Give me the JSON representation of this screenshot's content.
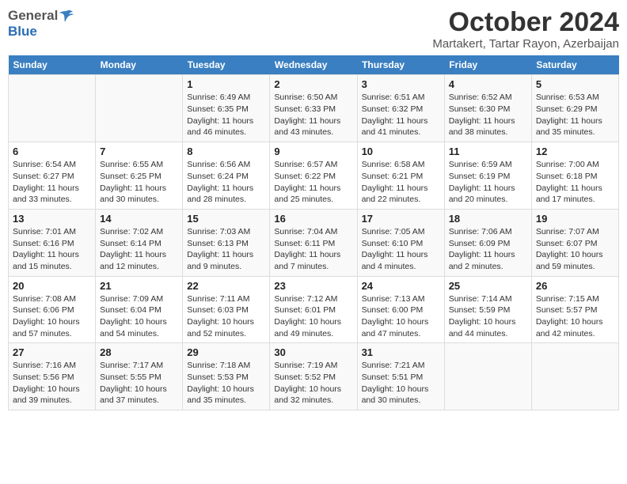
{
  "header": {
    "logo_general": "General",
    "logo_blue": "Blue",
    "month_title": "October 2024",
    "location": "Martakert, Tartar Rayon, Azerbaijan"
  },
  "weekdays": [
    "Sunday",
    "Monday",
    "Tuesday",
    "Wednesday",
    "Thursday",
    "Friday",
    "Saturday"
  ],
  "weeks": [
    [
      {
        "day": "",
        "sunrise": "",
        "sunset": "",
        "daylight": ""
      },
      {
        "day": "",
        "sunrise": "",
        "sunset": "",
        "daylight": ""
      },
      {
        "day": "1",
        "sunrise": "Sunrise: 6:49 AM",
        "sunset": "Sunset: 6:35 PM",
        "daylight": "Daylight: 11 hours and 46 minutes."
      },
      {
        "day": "2",
        "sunrise": "Sunrise: 6:50 AM",
        "sunset": "Sunset: 6:33 PM",
        "daylight": "Daylight: 11 hours and 43 minutes."
      },
      {
        "day": "3",
        "sunrise": "Sunrise: 6:51 AM",
        "sunset": "Sunset: 6:32 PM",
        "daylight": "Daylight: 11 hours and 41 minutes."
      },
      {
        "day": "4",
        "sunrise": "Sunrise: 6:52 AM",
        "sunset": "Sunset: 6:30 PM",
        "daylight": "Daylight: 11 hours and 38 minutes."
      },
      {
        "day": "5",
        "sunrise": "Sunrise: 6:53 AM",
        "sunset": "Sunset: 6:29 PM",
        "daylight": "Daylight: 11 hours and 35 minutes."
      }
    ],
    [
      {
        "day": "6",
        "sunrise": "Sunrise: 6:54 AM",
        "sunset": "Sunset: 6:27 PM",
        "daylight": "Daylight: 11 hours and 33 minutes."
      },
      {
        "day": "7",
        "sunrise": "Sunrise: 6:55 AM",
        "sunset": "Sunset: 6:25 PM",
        "daylight": "Daylight: 11 hours and 30 minutes."
      },
      {
        "day": "8",
        "sunrise": "Sunrise: 6:56 AM",
        "sunset": "Sunset: 6:24 PM",
        "daylight": "Daylight: 11 hours and 28 minutes."
      },
      {
        "day": "9",
        "sunrise": "Sunrise: 6:57 AM",
        "sunset": "Sunset: 6:22 PM",
        "daylight": "Daylight: 11 hours and 25 minutes."
      },
      {
        "day": "10",
        "sunrise": "Sunrise: 6:58 AM",
        "sunset": "Sunset: 6:21 PM",
        "daylight": "Daylight: 11 hours and 22 minutes."
      },
      {
        "day": "11",
        "sunrise": "Sunrise: 6:59 AM",
        "sunset": "Sunset: 6:19 PM",
        "daylight": "Daylight: 11 hours and 20 minutes."
      },
      {
        "day": "12",
        "sunrise": "Sunrise: 7:00 AM",
        "sunset": "Sunset: 6:18 PM",
        "daylight": "Daylight: 11 hours and 17 minutes."
      }
    ],
    [
      {
        "day": "13",
        "sunrise": "Sunrise: 7:01 AM",
        "sunset": "Sunset: 6:16 PM",
        "daylight": "Daylight: 11 hours and 15 minutes."
      },
      {
        "day": "14",
        "sunrise": "Sunrise: 7:02 AM",
        "sunset": "Sunset: 6:14 PM",
        "daylight": "Daylight: 11 hours and 12 minutes."
      },
      {
        "day": "15",
        "sunrise": "Sunrise: 7:03 AM",
        "sunset": "Sunset: 6:13 PM",
        "daylight": "Daylight: 11 hours and 9 minutes."
      },
      {
        "day": "16",
        "sunrise": "Sunrise: 7:04 AM",
        "sunset": "Sunset: 6:11 PM",
        "daylight": "Daylight: 11 hours and 7 minutes."
      },
      {
        "day": "17",
        "sunrise": "Sunrise: 7:05 AM",
        "sunset": "Sunset: 6:10 PM",
        "daylight": "Daylight: 11 hours and 4 minutes."
      },
      {
        "day": "18",
        "sunrise": "Sunrise: 7:06 AM",
        "sunset": "Sunset: 6:09 PM",
        "daylight": "Daylight: 11 hours and 2 minutes."
      },
      {
        "day": "19",
        "sunrise": "Sunrise: 7:07 AM",
        "sunset": "Sunset: 6:07 PM",
        "daylight": "Daylight: 10 hours and 59 minutes."
      }
    ],
    [
      {
        "day": "20",
        "sunrise": "Sunrise: 7:08 AM",
        "sunset": "Sunset: 6:06 PM",
        "daylight": "Daylight: 10 hours and 57 minutes."
      },
      {
        "day": "21",
        "sunrise": "Sunrise: 7:09 AM",
        "sunset": "Sunset: 6:04 PM",
        "daylight": "Daylight: 10 hours and 54 minutes."
      },
      {
        "day": "22",
        "sunrise": "Sunrise: 7:11 AM",
        "sunset": "Sunset: 6:03 PM",
        "daylight": "Daylight: 10 hours and 52 minutes."
      },
      {
        "day": "23",
        "sunrise": "Sunrise: 7:12 AM",
        "sunset": "Sunset: 6:01 PM",
        "daylight": "Daylight: 10 hours and 49 minutes."
      },
      {
        "day": "24",
        "sunrise": "Sunrise: 7:13 AM",
        "sunset": "Sunset: 6:00 PM",
        "daylight": "Daylight: 10 hours and 47 minutes."
      },
      {
        "day": "25",
        "sunrise": "Sunrise: 7:14 AM",
        "sunset": "Sunset: 5:59 PM",
        "daylight": "Daylight: 10 hours and 44 minutes."
      },
      {
        "day": "26",
        "sunrise": "Sunrise: 7:15 AM",
        "sunset": "Sunset: 5:57 PM",
        "daylight": "Daylight: 10 hours and 42 minutes."
      }
    ],
    [
      {
        "day": "27",
        "sunrise": "Sunrise: 7:16 AM",
        "sunset": "Sunset: 5:56 PM",
        "daylight": "Daylight: 10 hours and 39 minutes."
      },
      {
        "day": "28",
        "sunrise": "Sunrise: 7:17 AM",
        "sunset": "Sunset: 5:55 PM",
        "daylight": "Daylight: 10 hours and 37 minutes."
      },
      {
        "day": "29",
        "sunrise": "Sunrise: 7:18 AM",
        "sunset": "Sunset: 5:53 PM",
        "daylight": "Daylight: 10 hours and 35 minutes."
      },
      {
        "day": "30",
        "sunrise": "Sunrise: 7:19 AM",
        "sunset": "Sunset: 5:52 PM",
        "daylight": "Daylight: 10 hours and 32 minutes."
      },
      {
        "day": "31",
        "sunrise": "Sunrise: 7:21 AM",
        "sunset": "Sunset: 5:51 PM",
        "daylight": "Daylight: 10 hours and 30 minutes."
      },
      {
        "day": "",
        "sunrise": "",
        "sunset": "",
        "daylight": ""
      },
      {
        "day": "",
        "sunrise": "",
        "sunset": "",
        "daylight": ""
      }
    ]
  ]
}
